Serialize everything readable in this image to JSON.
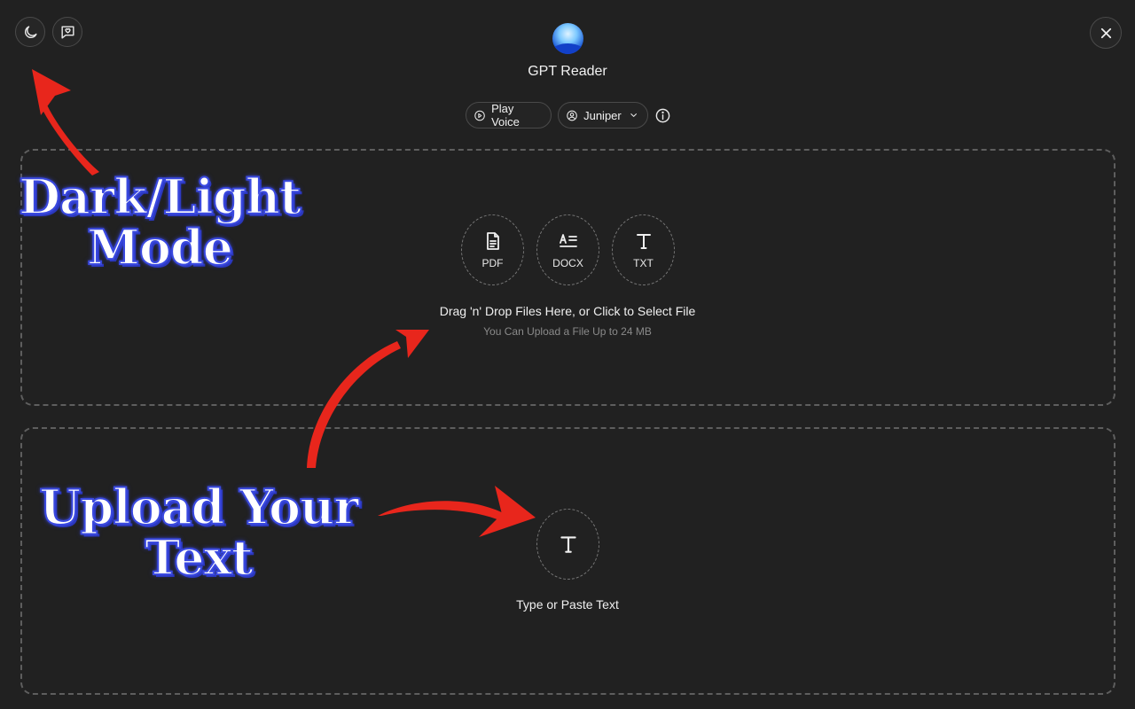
{
  "header": {
    "app_title": "GPT Reader",
    "play_voice_label": "Play Voice",
    "voice_name": "Juniper"
  },
  "file_upload": {
    "types": [
      {
        "label": "PDF",
        "icon": "pdf-file-icon"
      },
      {
        "label": "DOCX",
        "icon": "docx-file-icon"
      },
      {
        "label": "TXT",
        "icon": "text-t-icon"
      }
    ],
    "instruction": "Drag 'n' Drop Files Here, or Click to Select File",
    "limit_note": "You Can Upload a File Up to 24 MB"
  },
  "text_input": {
    "label": "Type or Paste Text",
    "icon": "text-t-icon"
  },
  "annotations": {
    "dark_light": "Dark/Light Mode",
    "upload": "Upload Your Text"
  },
  "icons": [
    "moon-icon",
    "feedback-icon",
    "close-icon",
    "play-circle-icon",
    "user-icon",
    "chevron-down-icon",
    "info-icon"
  ],
  "colors": {
    "background": "#212121",
    "annotation_arrow": "#e8261c",
    "annotation_text_outline": "#3a49e0"
  }
}
